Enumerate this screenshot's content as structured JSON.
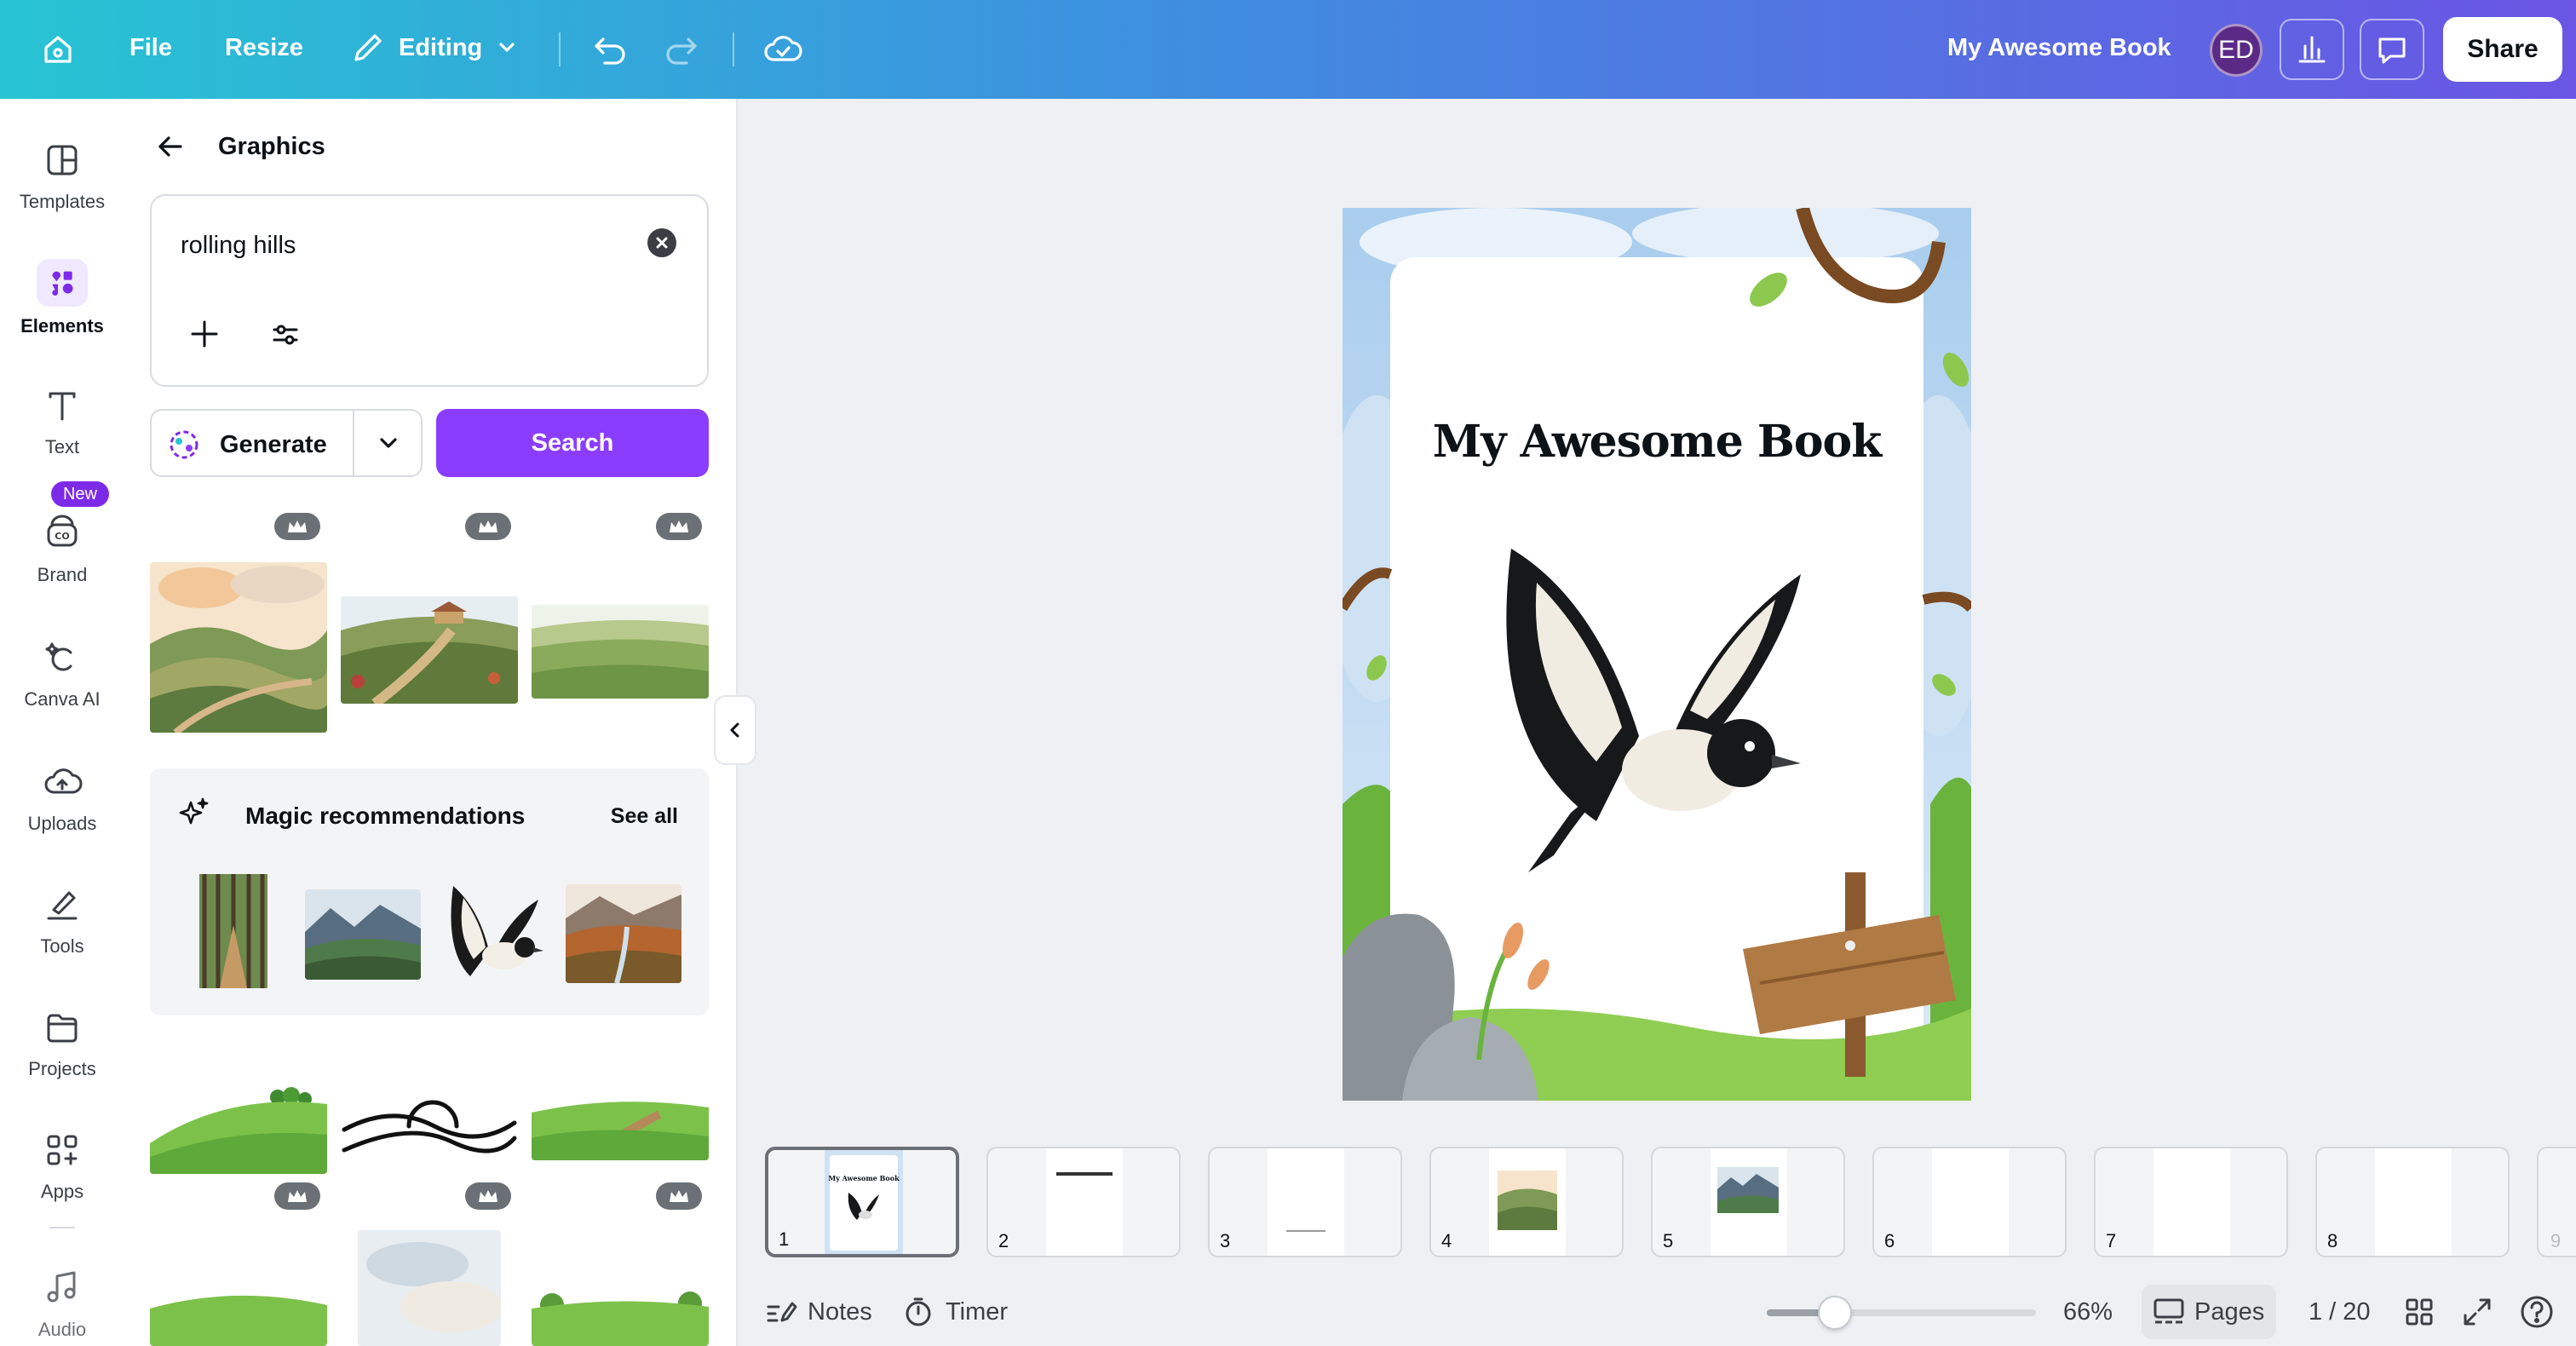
{
  "topbar": {
    "file": "File",
    "resize": "Resize",
    "mode": "Editing",
    "doc_title": "My Awesome Book",
    "avatar": "ED",
    "share": "Share"
  },
  "rail": {
    "templates": "Templates",
    "elements": "Elements",
    "text": "Text",
    "brand": "Brand",
    "new_badge": "New",
    "canva_ai": "Canva AI",
    "uploads": "Uploads",
    "tools": "Tools",
    "projects": "Projects",
    "apps": "Apps",
    "audio": "Audio"
  },
  "panel": {
    "title": "Graphics",
    "query": "rolling hills",
    "generate": "Generate",
    "search": "Search",
    "magic_title": "Magic recommendations",
    "see_all": "See all"
  },
  "canvas": {
    "title": "My Awesome Book"
  },
  "pages": [
    {
      "n": "1"
    },
    {
      "n": "2"
    },
    {
      "n": "3"
    },
    {
      "n": "4"
    },
    {
      "n": "5"
    },
    {
      "n": "6"
    },
    {
      "n": "7"
    },
    {
      "n": "8"
    },
    {
      "n": "9"
    }
  ],
  "bottombar": {
    "notes": "Notes",
    "timer": "Timer",
    "zoom": "66%",
    "pages": "Pages",
    "page_count": "1 / 20"
  },
  "colors": {
    "accent": "#8b3dff",
    "topbar_start": "#27c4d3",
    "topbar_end": "#6a55e4"
  }
}
